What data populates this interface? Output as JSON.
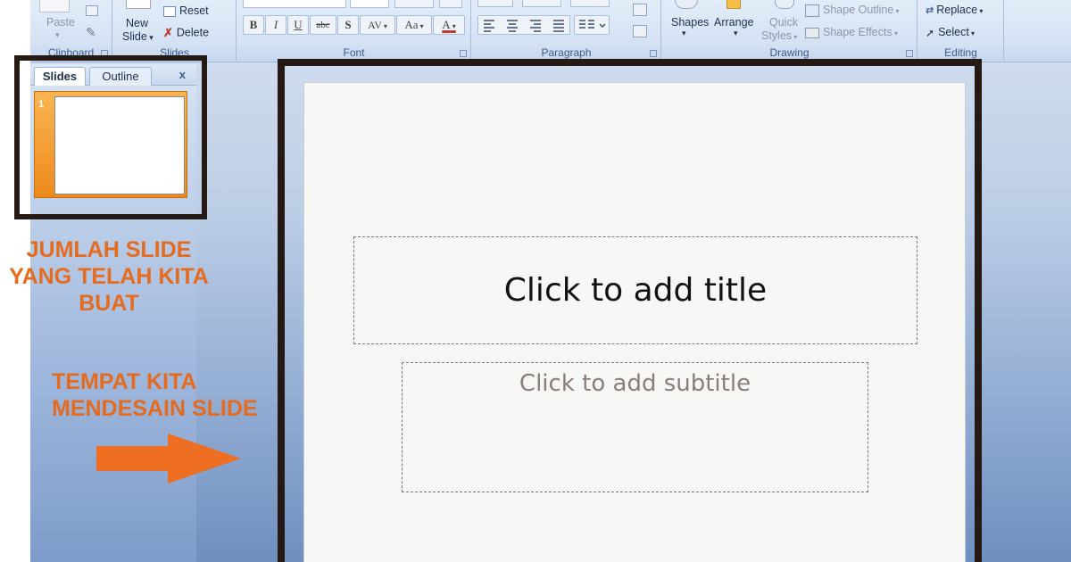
{
  "ribbon": {
    "clipboard": {
      "paste": "Paste",
      "label": "Clipboard"
    },
    "slides": {
      "new_slide_line1": "New",
      "new_slide_line2": "Slide",
      "reset": "Reset",
      "delete": "Delete",
      "label": "Slides"
    },
    "font": {
      "label": "Font",
      "bold": "B",
      "italic": "I",
      "underline": "U",
      "strike": "abc",
      "shadow": "S",
      "spacing": "AV",
      "case": "Aa",
      "color": "A"
    },
    "paragraph": {
      "label": "Paragraph"
    },
    "drawing": {
      "label": "Drawing",
      "shapes": "Shapes",
      "arrange": "Arrange",
      "quick_styles_line1": "Quick",
      "quick_styles_line2": "Styles",
      "shape_outline": "Shape Outline",
      "shape_effects": "Shape Effects"
    },
    "editing": {
      "label": "Editing",
      "replace": "Replace",
      "select": "Select"
    }
  },
  "slides_pane": {
    "tab_slides": "Slides",
    "tab_outline": "Outline",
    "close": "x",
    "thumbnails": [
      {
        "number": "1"
      }
    ]
  },
  "slide": {
    "title_placeholder": "Click to add title",
    "subtitle_placeholder": "Click to add subtitle"
  },
  "annotations": {
    "slide_count": [
      "JUMLAH SLIDE",
      "YANG TELAH KITA",
      "BUAT"
    ],
    "design_area": [
      "TEMPAT KITA",
      "MENDESAIN SLIDE"
    ],
    "color": "#e56b1f"
  }
}
